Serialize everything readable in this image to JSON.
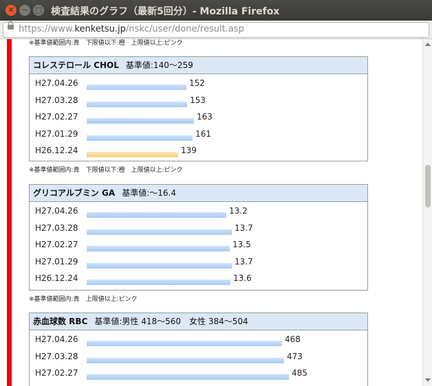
{
  "window": {
    "title": "検査結果のグラフ（最新5回分）- Mozilla Firefox"
  },
  "browser": {
    "url_prefix": "https://www.",
    "url_domain": "kenketsu.jp",
    "url_path": "/nskc/user/done/result.asp"
  },
  "notes": {
    "top": "※基準値範囲内:青　下限値以下:橙　上限値以上:ピンク",
    "chol": "※基準値範囲内:青　下限値以下:橙　上限値以上:ピンク",
    "ga": "※基準値範囲内:青　上限値以上:ピンク"
  },
  "chol": {
    "name": "コレステロール CHOL",
    "ref": "基準値:140〜259",
    "rows": [
      {
        "date": "H27.04.26",
        "value": "152"
      },
      {
        "date": "H27.03.28",
        "value": "153"
      },
      {
        "date": "H27.02.27",
        "value": "163"
      },
      {
        "date": "H27.01.29",
        "value": "161"
      },
      {
        "date": "H26.12.24",
        "value": "139",
        "status": "low"
      }
    ]
  },
  "ga": {
    "name": "グリコアルブミン GA",
    "ref": "基準値:〜16.4",
    "rows": [
      {
        "date": "H27.04.26",
        "value": "13.2"
      },
      {
        "date": "H27.03.28",
        "value": "13.7"
      },
      {
        "date": "H27.02.27",
        "value": "13.5"
      },
      {
        "date": "H27.01.29",
        "value": "13.7"
      },
      {
        "date": "H26.12.24",
        "value": "13.6"
      }
    ]
  },
  "rbc": {
    "name": "赤血球数 RBC",
    "ref": "基準値:男性 418〜560　女性 384〜504",
    "rows": [
      {
        "date": "H27.04.26",
        "value": "468"
      },
      {
        "date": "H27.03.28",
        "value": "473"
      },
      {
        "date": "H27.02.27",
        "value": "485"
      }
    ]
  },
  "colors": {
    "in_range": "#a9c9f2",
    "below_range": "#f3d27e",
    "accent_bar": "#ee0000",
    "header_bg": "#dce8f8"
  }
}
